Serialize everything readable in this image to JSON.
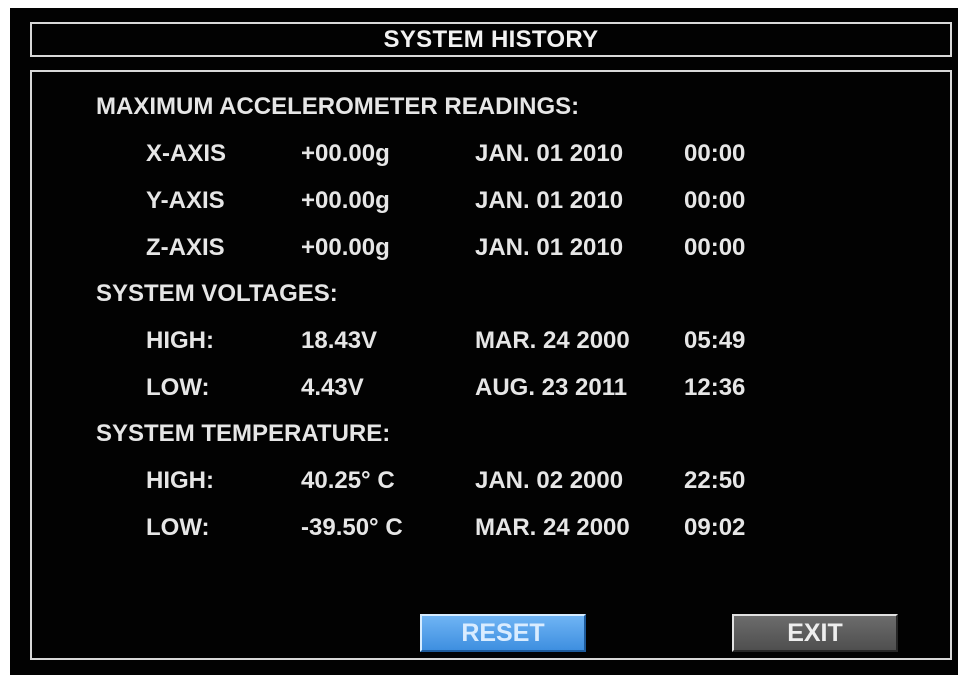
{
  "title": "SYSTEM HISTORY",
  "accelerometer": {
    "heading": "MAXIMUM ACCELEROMETER READINGS:",
    "rows": [
      {
        "label": "X-AXIS",
        "value": "+00.00g",
        "date": "JAN. 01 2010",
        "time": "00:00"
      },
      {
        "label": "Y-AXIS",
        "value": "+00.00g",
        "date": "JAN. 01 2010",
        "time": "00:00"
      },
      {
        "label": "Z-AXIS",
        "value": "+00.00g",
        "date": "JAN. 01 2010",
        "time": "00:00"
      }
    ]
  },
  "voltages": {
    "heading": "SYSTEM VOLTAGES:",
    "rows": [
      {
        "label": "HIGH:",
        "value": "18.43V",
        "date": "MAR. 24 2000",
        "time": "05:49"
      },
      {
        "label": "LOW:",
        "value": "4.43V",
        "date": "AUG. 23 2011",
        "time": "12:36"
      }
    ]
  },
  "temperature": {
    "heading": "SYSTEM TEMPERATURE:",
    "rows": [
      {
        "label": "HIGH:",
        "value": "40.25° C",
        "date": "JAN. 02 2000",
        "time": "22:50"
      },
      {
        "label": "LOW:",
        "value": "-39.50° C",
        "date": "MAR. 24 2000",
        "time": "09:02"
      }
    ]
  },
  "buttons": {
    "reset": "RESET",
    "exit": "EXIT"
  },
  "colors": {
    "background": "#020202",
    "text": "#e6e6e6",
    "reset_button": "#4f9fe8",
    "exit_button": "#5e5e5e",
    "border": "#d8d8d8"
  }
}
